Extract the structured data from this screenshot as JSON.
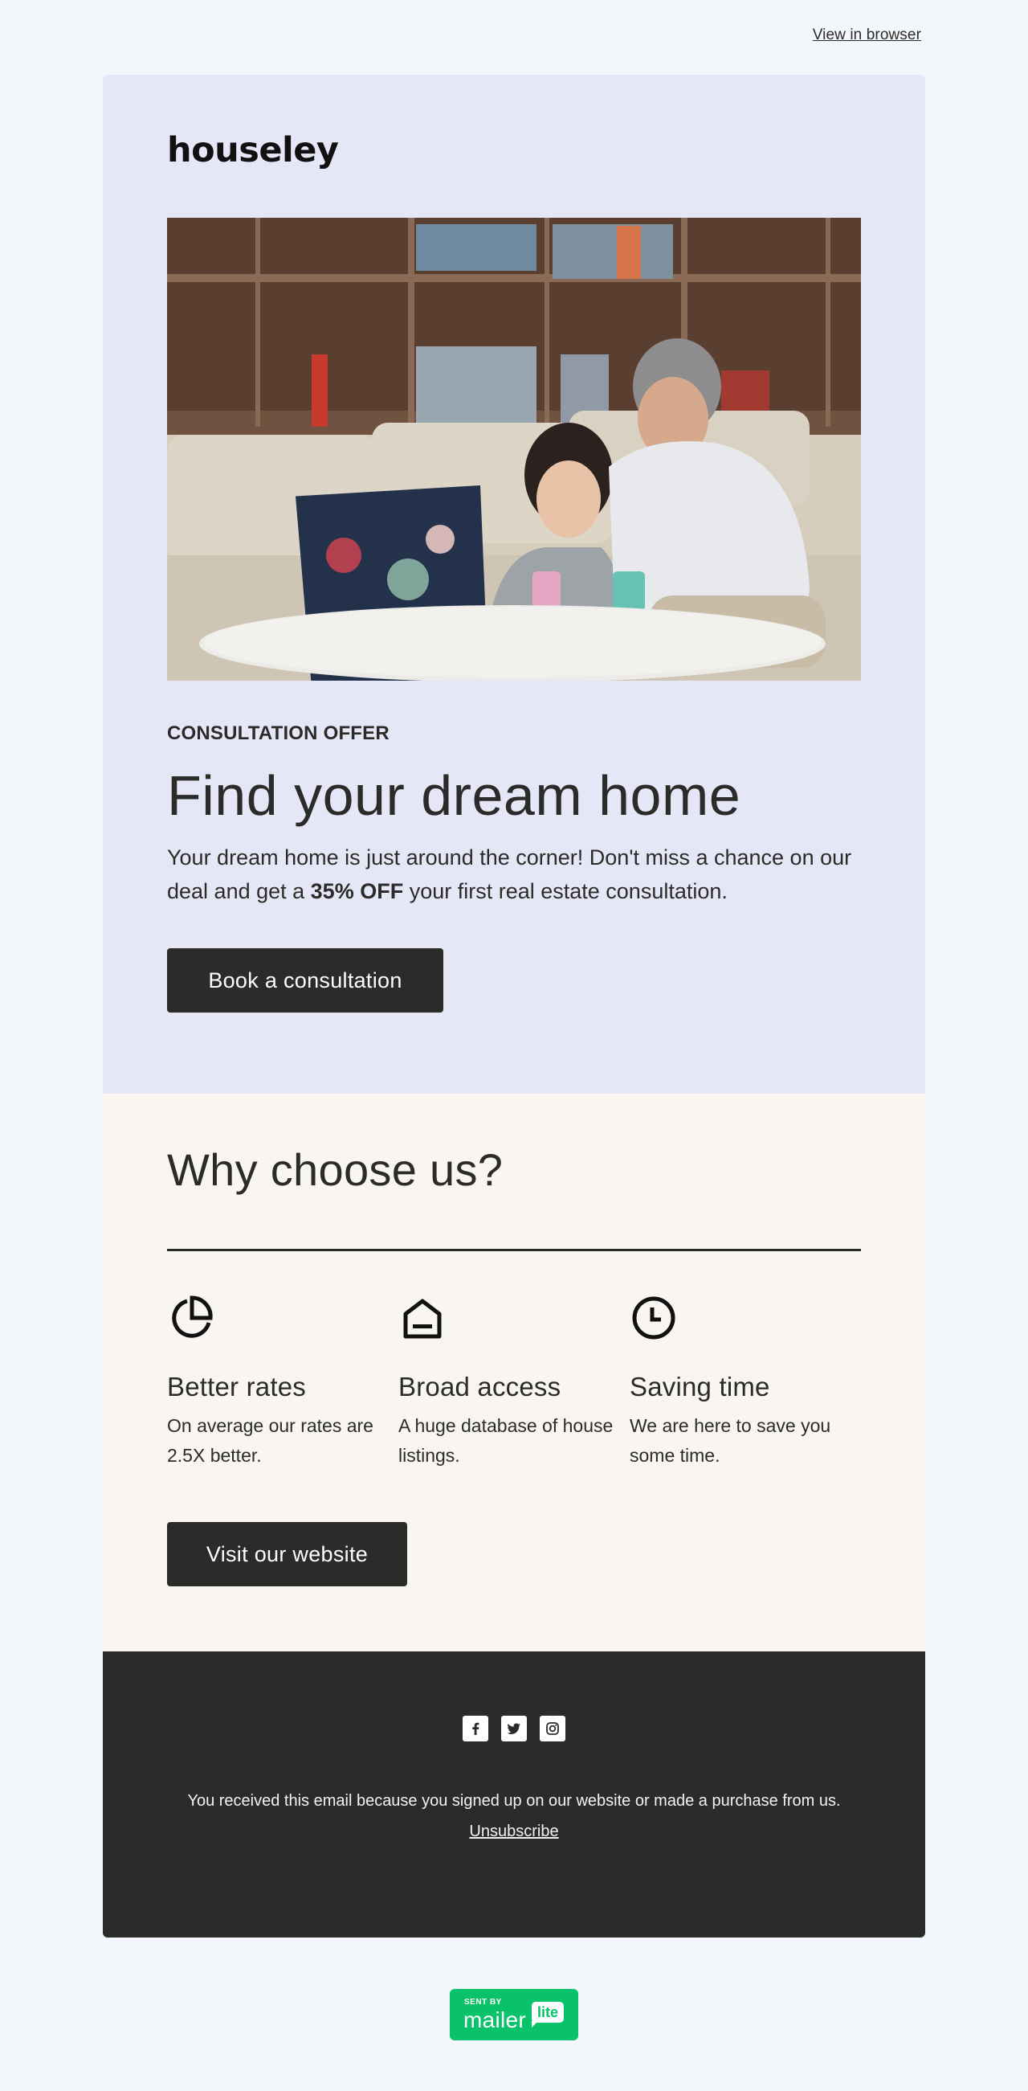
{
  "topbar": {
    "view_in_browser": "View in browser"
  },
  "hero": {
    "logo": "houseley",
    "image_alt": "Father and daughter playing with bead toys on a sofa",
    "eyebrow": "CONSULTATION OFFER",
    "headline": "Find your dream home",
    "lead_before": "Your dream home is just around the corner! Don't miss a chance on our deal and get a ",
    "lead_bold": "35% OFF",
    "lead_after": " your first real estate consultation.",
    "cta_label": "Book a consultation"
  },
  "why": {
    "title": "Why choose us?",
    "features": [
      {
        "icon": "pie-chart-icon",
        "title": "Better rates",
        "description": "On average our rates are 2.5X better."
      },
      {
        "icon": "house-icon",
        "title": "Broad access",
        "description": "A huge database of house listings."
      },
      {
        "icon": "clock-icon",
        "title": "Saving time",
        "description": "We are here to save you some time."
      }
    ],
    "cta_label": "Visit our website"
  },
  "footer": {
    "socials": [
      {
        "icon": "facebook-icon",
        "label": "Facebook"
      },
      {
        "icon": "twitter-icon",
        "label": "Twitter"
      },
      {
        "icon": "instagram-icon",
        "label": "Instagram"
      }
    ],
    "notice": "You received this email because you signed up on our website or made a purchase from us.",
    "unsubscribe": "Unsubscribe"
  },
  "badge": {
    "sent_by": "SENT BY",
    "brand": "mailer",
    "brand_suffix": "lite"
  },
  "colors": {
    "page_background": "#f3f6fa",
    "hero_background": "#e6e7f6",
    "why_background": "#f9f6f2",
    "dark": "#2b2c29",
    "badge_green": "#09c269"
  }
}
